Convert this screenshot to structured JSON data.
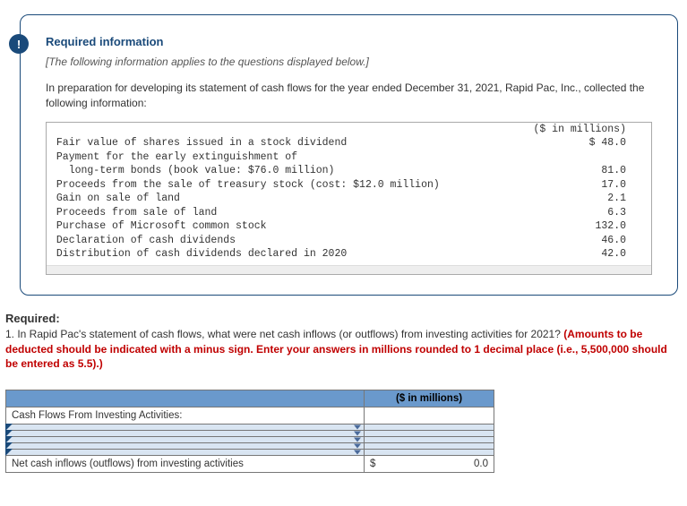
{
  "badge_text": "!",
  "card": {
    "heading": "Required information",
    "italic": "[The following information applies to the questions displayed below.]",
    "intro": "In preparation for developing its statement of cash flows for the year ended December 31, 2021, Rapid Pac, Inc., collected the following information:",
    "col_header": "($ in millions)",
    "rows": [
      {
        "label": " Fair value of shares issued in a stock dividend",
        "value": "$ 48.0"
      },
      {
        "label": " Payment for the early extinguishment of",
        "value": ""
      },
      {
        "label": "   long-term bonds (book value: $76.0 million)",
        "value": "81.0"
      },
      {
        "label": " Proceeds from the sale of treasury stock (cost: $12.0 million)",
        "value": "17.0"
      },
      {
        "label": " Gain on sale of land",
        "value": "2.1"
      },
      {
        "label": " Proceeds from sale of land",
        "value": "6.3"
      },
      {
        "label": " Purchase of Microsoft common stock",
        "value": "132.0"
      },
      {
        "label": " Declaration of cash dividends",
        "value": "46.0"
      },
      {
        "label": " Distribution of cash dividends declared in 2020",
        "value": "42.0"
      }
    ]
  },
  "question": {
    "req_label": "Required:",
    "text_black": "1. In Rapid Pac's statement of cash flows, what were net cash inflows (or outflows) from investing activities for 2021? ",
    "text_red": "(Amounts to be deducted should be indicated with a minus sign. Enter your answers in millions rounded to 1 decimal place (i.e., 5,500,000 should be entered as 5.5).)"
  },
  "answer": {
    "amt_header": "($ in millions)",
    "row_title": "Cash Flows From Investing Activities:",
    "total_label": " Net cash inflows (outflows) from investing activities",
    "total_currency": "$",
    "total_value": "0.0"
  }
}
